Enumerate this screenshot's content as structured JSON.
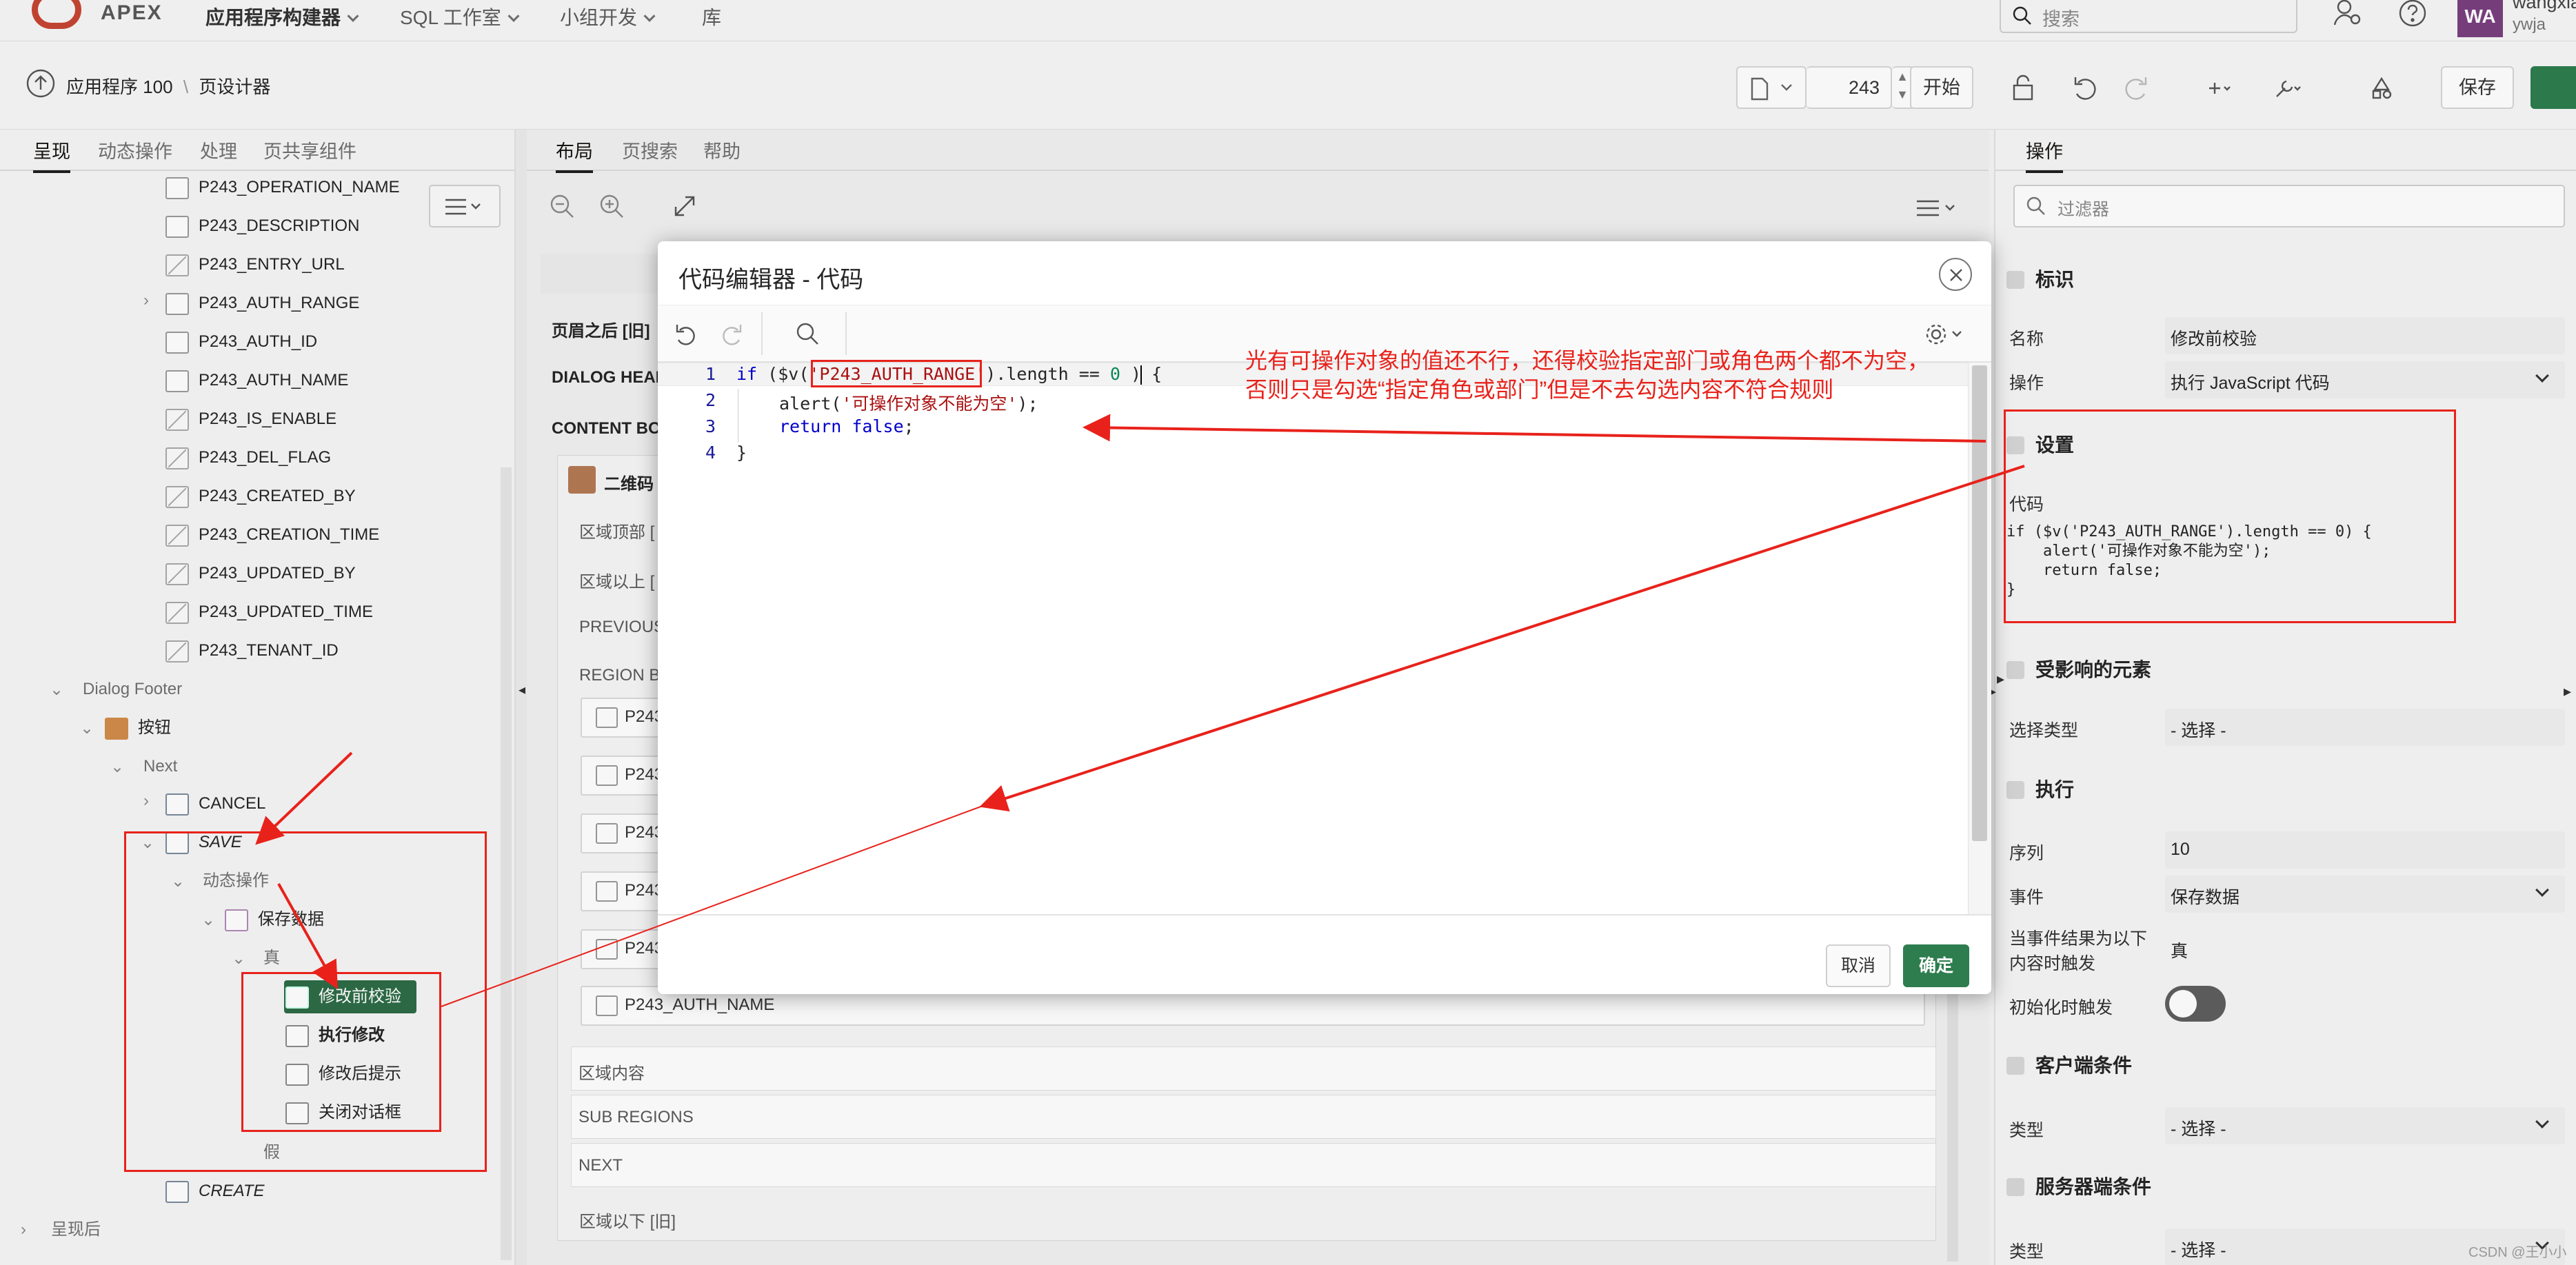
{
  "topnav": {
    "brand": "APEX",
    "menu": [
      "应用程序构建器",
      "SQL 工作室",
      "小组开发",
      "库"
    ],
    "search_placeholder": "搜索",
    "user": {
      "initials": "WA",
      "name": "wangxia",
      "sub": "ywja"
    }
  },
  "toolbar": {
    "breadcrumb_app": "应用程序 100",
    "breadcrumb_sep": "\\",
    "breadcrumb_page": "页设计器",
    "page_number": "243",
    "start_label": "开始",
    "save_label": "保存"
  },
  "left": {
    "tabs": [
      "呈现",
      "动态操作",
      "处理",
      "页共享组件"
    ],
    "tree": [
      {
        "label": "P243_OPERATION_NAME"
      },
      {
        "label": "P243_DESCRIPTION"
      },
      {
        "label": "P243_ENTRY_URL"
      },
      {
        "label": "P243_AUTH_RANGE"
      },
      {
        "label": "P243_AUTH_ID"
      },
      {
        "label": "P243_AUTH_NAME"
      },
      {
        "label": "P243_IS_ENABLE"
      },
      {
        "label": "P243_DEL_FLAG"
      },
      {
        "label": "P243_CREATED_BY"
      },
      {
        "label": "P243_CREATION_TIME"
      },
      {
        "label": "P243_UPDATED_BY"
      },
      {
        "label": "P243_UPDATED_TIME"
      },
      {
        "label": "P243_TENANT_ID"
      },
      {
        "label": "Dialog Footer"
      },
      {
        "label": "按钮"
      },
      {
        "label": "Next"
      },
      {
        "label": "CANCEL"
      },
      {
        "label": "SAVE"
      },
      {
        "label": "动态操作"
      },
      {
        "label": "保存数据"
      },
      {
        "label": "真"
      },
      {
        "label": "修改前校验"
      },
      {
        "label": "执行修改"
      },
      {
        "label": "修改后提示"
      },
      {
        "label": "关闭对话框"
      },
      {
        "label": "假"
      },
      {
        "label": "CREATE"
      },
      {
        "label": "呈现后"
      }
    ]
  },
  "center": {
    "tabs": [
      "布局",
      "页搜索",
      "帮助"
    ],
    "labels": [
      "页眉之后 [旧]",
      "DIALOG HEAD",
      "CONTENT BO",
      "二维码",
      "区域顶部 [",
      "区域以上 [",
      "PREVIOUS",
      "REGION BO",
      "P243",
      "P243",
      "P243",
      "P243",
      "P243",
      "P243_AUTH_NAME",
      "区域内容",
      "SUB REGIONS",
      "NEXT",
      "区域以下 [旧]"
    ]
  },
  "modal": {
    "title": "代码编辑器 - 代码",
    "code_lines": [
      {
        "n": "1",
        "text": "if ($v('P243_AUTH_RANGE').length == 0 ) {"
      },
      {
        "n": "2",
        "text": "alert('可操作对象不能为空');"
      },
      {
        "n": "3",
        "text": "return false;"
      },
      {
        "n": "4",
        "text": "}"
      }
    ],
    "cancel_label": "取消",
    "ok_label": "确定"
  },
  "right": {
    "tab": "操作",
    "filter_placeholder": "过滤器",
    "sections": {
      "identity": "标识",
      "settings": "设置",
      "affected": "受影响的元素",
      "execution": "执行",
      "client_cond": "客户端条件",
      "server_cond": "服务器端条件"
    },
    "props": {
      "name_label": "名称",
      "name_value": "修改前校验",
      "action_label": "操作",
      "action_value": "执行 JavaScript 代码",
      "code_label": "代码",
      "code_value": "if ($v('P243_AUTH_RANGE').length == 0) {\n    alert('可操作对象不能为空');\n    return false;\n}",
      "seltype_label": "选择类型",
      "seltype_value": "- 选择 -",
      "seq_label": "序列",
      "seq_value": "10",
      "event_label": "事件",
      "event_value": "保存数据",
      "fire_label_1": "当事件结果为以下",
      "fire_label_2": "内容时触发",
      "fire_value": "真",
      "init_label": "初始化时触发",
      "client_type_label": "类型",
      "client_type_value": "- 选择 -",
      "server_type_label": "类型",
      "server_type_value": "- 选择 -"
    }
  },
  "annotation": {
    "line1": "光有可操作对象的值还不行，还得校验指定部门或角色两个都不为空，",
    "line2": "否则只是勾选“指定角色或部门”但是不去勾选内容不符合规则"
  },
  "watermark": "CSDN @王小小鸭",
  "colors": {
    "accent": "#2e7d4f",
    "annotation": "#e8221b",
    "brand": "#c74634"
  }
}
